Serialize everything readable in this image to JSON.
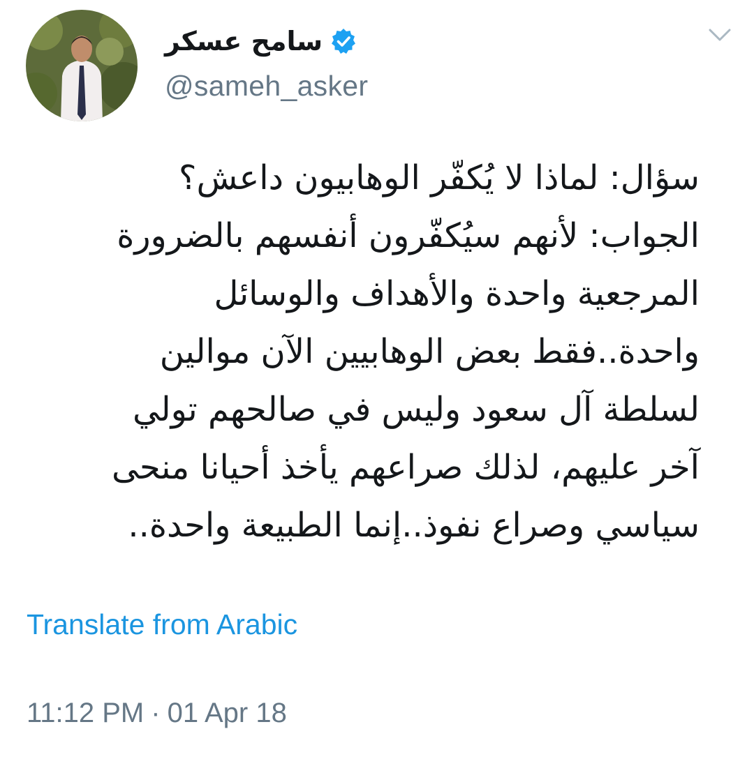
{
  "author": {
    "display_name": "سامح عسكر",
    "handle": "@sameh_asker",
    "verified": true
  },
  "tweet": {
    "lines": [
      "سؤال: لماذا لا يُكفّر الوهابيون داعش؟",
      "الجواب: لأنهم سيُكفّرون أنفسهم بالضرورة",
      "المرجعية واحدة والأهداف والوسائل",
      "واحدة..فقط بعض الوهابيين الآن موالين",
      "لسلطة آل سعود وليس في صالحهم تولي",
      "آخر عليهم، لذلك صراعهم يأخذ أحيانا منحى",
      "سياسي وصراع نفوذ..إنما الطبيعة واحدة.."
    ],
    "translate_label": "Translate from Arabic",
    "time": "11:12 PM",
    "separator": "·",
    "date": "01 Apr 18"
  },
  "icons": {
    "verified": "verified-badge-icon",
    "menu": "chevron-down-icon"
  },
  "colors": {
    "link": "#1b95e0",
    "muted": "#657786",
    "verified": "#1da1f2",
    "text": "#14171a"
  }
}
